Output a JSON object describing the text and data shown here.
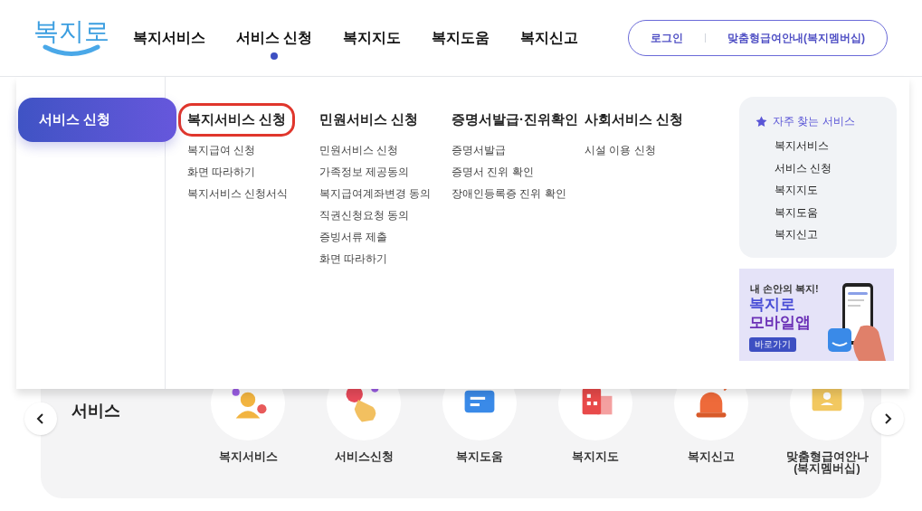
{
  "logo": {
    "text": "복지로"
  },
  "nav": [
    {
      "label": "복지서비스",
      "selected": false
    },
    {
      "label": "서비스 신청",
      "selected": true
    },
    {
      "label": "복지지도",
      "selected": false
    },
    {
      "label": "복지도움",
      "selected": false
    },
    {
      "label": "복지신고",
      "selected": false
    }
  ],
  "account": {
    "login": "로그인",
    "membership": "맞춤형급여안내(복지멤버십)"
  },
  "mega_menu": {
    "section": "서비스 신청",
    "columns": [
      {
        "title": "복지서비스 신청",
        "highlighted": true,
        "items": [
          "복지급여 신청",
          "화면 따라하기",
          "복지서비스 신청서식"
        ]
      },
      {
        "title": "민원서비스 신청",
        "highlighted": false,
        "items": [
          "민원서비스 신청",
          "가족정보 제공동의",
          "복지급여계좌변경 동의",
          "직권신청요청 동의",
          "증빙서류 제출",
          "화면 따라하기"
        ]
      },
      {
        "title": "증명서발급·진위확인",
        "highlighted": false,
        "items": [
          "증명서발급",
          "증명서 진위 확인",
          "장애인등록증 진위 확인"
        ]
      },
      {
        "title": "사회서비스 신청",
        "highlighted": false,
        "items": [
          "시설 이용 신청"
        ]
      }
    ],
    "favorites": {
      "title": "자주 찾는 서비스",
      "items": [
        "복지서비스",
        "서비스 신청",
        "복지지도",
        "복지도움",
        "복지신고"
      ]
    },
    "banner": {
      "tagline": "내 손안의 복지!",
      "title_line_1": "복지로",
      "title_line_2": "모바일앱",
      "button": "바로가기"
    }
  },
  "quick_services": {
    "heading": "서비스",
    "items": [
      {
        "label": "복지서비스",
        "kind": "person"
      },
      {
        "label": "서비스신청",
        "kind": "hand"
      },
      {
        "label": "복지도움",
        "kind": "chat"
      },
      {
        "label": "복지지도",
        "kind": "map"
      },
      {
        "label": "복지신고",
        "kind": "siren"
      },
      {
        "label": "맞춤형급여안나\n(복지멤버십)",
        "kind": "card"
      }
    ]
  }
}
